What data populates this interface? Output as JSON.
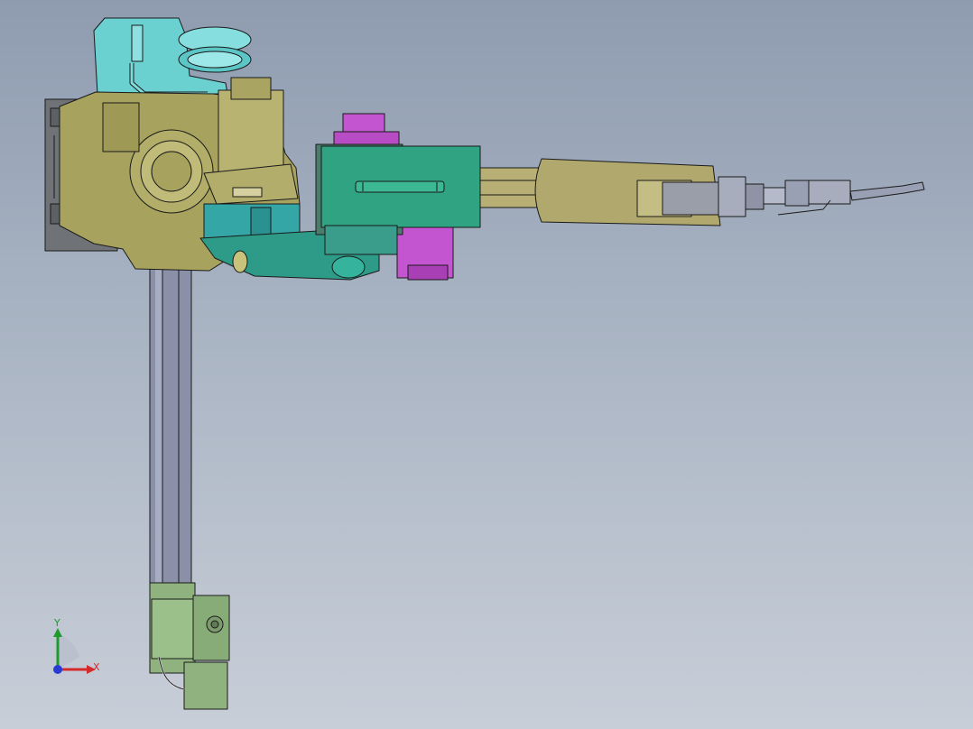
{
  "viewport": {
    "background_top": "#8f9cb0",
    "background_bottom": "#c8ced8"
  },
  "model": {
    "name": "welding-robot-on-vertical-column",
    "part_colors": {
      "base_body": "#a7a35e",
      "base_plate": "#6f7276",
      "reducer_housing": "#6ad0d0",
      "column": "#8a90a8",
      "lower_motor": "#8fb27e",
      "teal_bracket": "#2e9b88",
      "magenta_motor": "#c455d0",
      "green_cover": "#2fa382",
      "forearm": "#b0a86c",
      "wrist_and_torch": "#a7adbd"
    }
  },
  "triad": {
    "x_label": "X",
    "y_label": "Y",
    "x_color": "#d42a2a",
    "y_color": "#1f9b2e",
    "z_color": "#2a3bd4"
  }
}
